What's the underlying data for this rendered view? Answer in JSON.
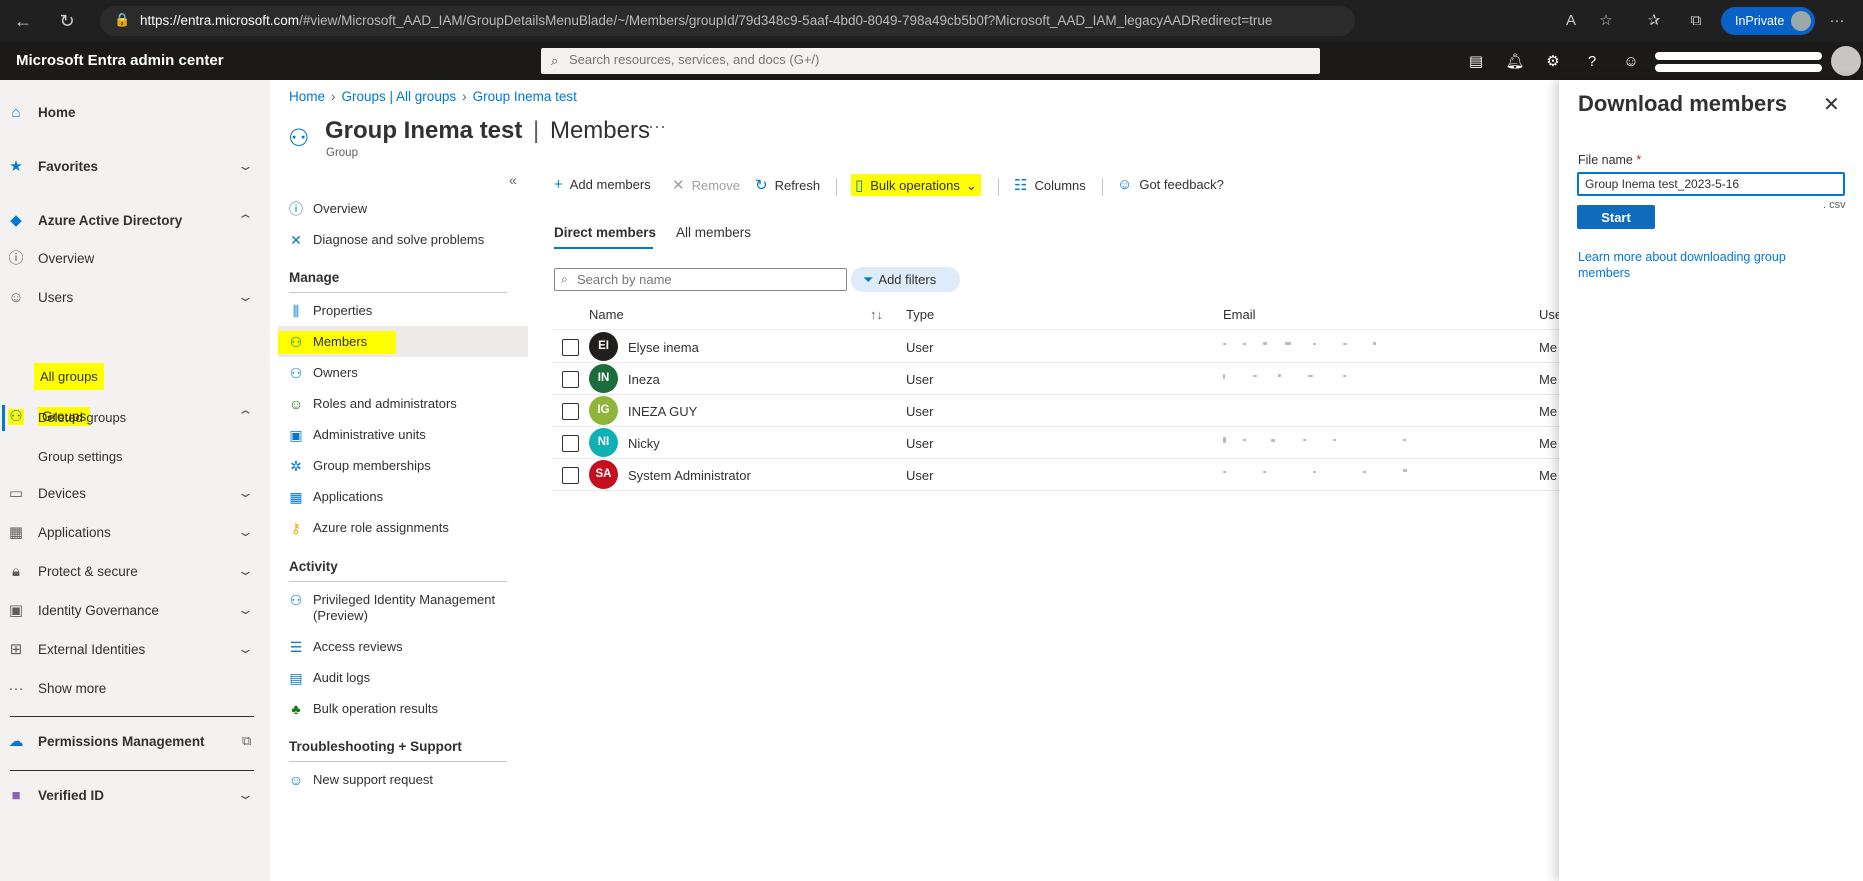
{
  "browser": {
    "url_host": "https://entra.microsoft.com",
    "url_path": "/#view/Microsoft_AAD_IAM/GroupDetailsMenuBlade/~/Members/groupId/79d348c9-5aaf-4bd0-8049-798a49cb5b0f?Microsoft_AAD_IAM_legacyAADRedirect=true",
    "inprivate_label": "InPrivate"
  },
  "header": {
    "brand": "Microsoft Entra admin center",
    "search_placeholder": "Search resources, services, and docs (G+/)"
  },
  "leftnav": {
    "home": "Home",
    "favorites": "Favorites",
    "aad": "Azure Active Directory",
    "overview": "Overview",
    "users": "Users",
    "groups": "Groups",
    "all_groups": "All groups",
    "deleted_groups": "Deleted groups",
    "group_settings": "Group settings",
    "devices": "Devices",
    "applications": "Applications",
    "protect": "Protect & secure",
    "identity_governance": "Identity Governance",
    "external_identities": "External Identities",
    "show_more": "Show more",
    "permissions": "Permissions Management",
    "verified_id": "Verified ID"
  },
  "breadcrumb": {
    "home": "Home",
    "groups": "Groups | All groups",
    "group": "Group Inema test"
  },
  "page": {
    "title_name": "Group Inema test",
    "title_bar": "|",
    "title_section": "Members",
    "subtitle": "Group",
    "ellipsis": "···"
  },
  "resource_menu": {
    "collapse": "«",
    "overview": "Overview",
    "diagnose": "Diagnose and solve problems",
    "manage_header": "Manage",
    "properties": "Properties",
    "members": "Members",
    "owners": "Owners",
    "roles": "Roles and administrators",
    "admin_units": "Administrative units",
    "group_memberships": "Group memberships",
    "applications": "Applications",
    "azure_roles": "Azure role assignments",
    "activity_header": "Activity",
    "pim": "Privileged Identity Management (Preview)",
    "access_reviews": "Access reviews",
    "audit_logs": "Audit logs",
    "bulk_results": "Bulk operation results",
    "troubleshoot_header": "Troubleshooting + Support",
    "new_support": "New support request"
  },
  "toolbar": {
    "add_members": "Add members",
    "remove": "Remove",
    "refresh": "Refresh",
    "bulk_operations": "Bulk operations",
    "columns": "Columns",
    "feedback": "Got feedback?"
  },
  "tabs": {
    "direct": "Direct members",
    "all": "All members"
  },
  "member_search": {
    "placeholder": "Search by name"
  },
  "add_filters": "Add filters",
  "table": {
    "headers": {
      "name": "Name",
      "type": "Type",
      "email": "Email",
      "role": "Use"
    },
    "rows": [
      {
        "initials": "EI",
        "name": "Elyse inema",
        "type": "User",
        "role": "Me",
        "color": "#201f1e"
      },
      {
        "initials": "IN",
        "name": "Ineza",
        "type": "User",
        "role": "Me",
        "color": "#1b6e3c"
      },
      {
        "initials": "IG",
        "name": "INEZA GUY",
        "type": "User",
        "role": "Me",
        "color": "#8fb53a"
      },
      {
        "initials": "NI",
        "name": "Nicky",
        "type": "User",
        "role": "Me",
        "color": "#0fb0b4"
      },
      {
        "initials": "SA",
        "name": "System Administrator",
        "type": "User",
        "role": "Me",
        "color": "#c50f1f"
      }
    ]
  },
  "blade": {
    "title": "Download members",
    "file_name_label": "File name",
    "required_marker": "*",
    "file_name_value": "Group Inema test_2023-5-16",
    "extension": ". csv",
    "start": "Start",
    "learn_more": "Learn more about downloading group members"
  },
  "colors": {
    "accent": "#0078d4",
    "highlight": "#ffff00",
    "header_bg": "#1b1a19"
  }
}
